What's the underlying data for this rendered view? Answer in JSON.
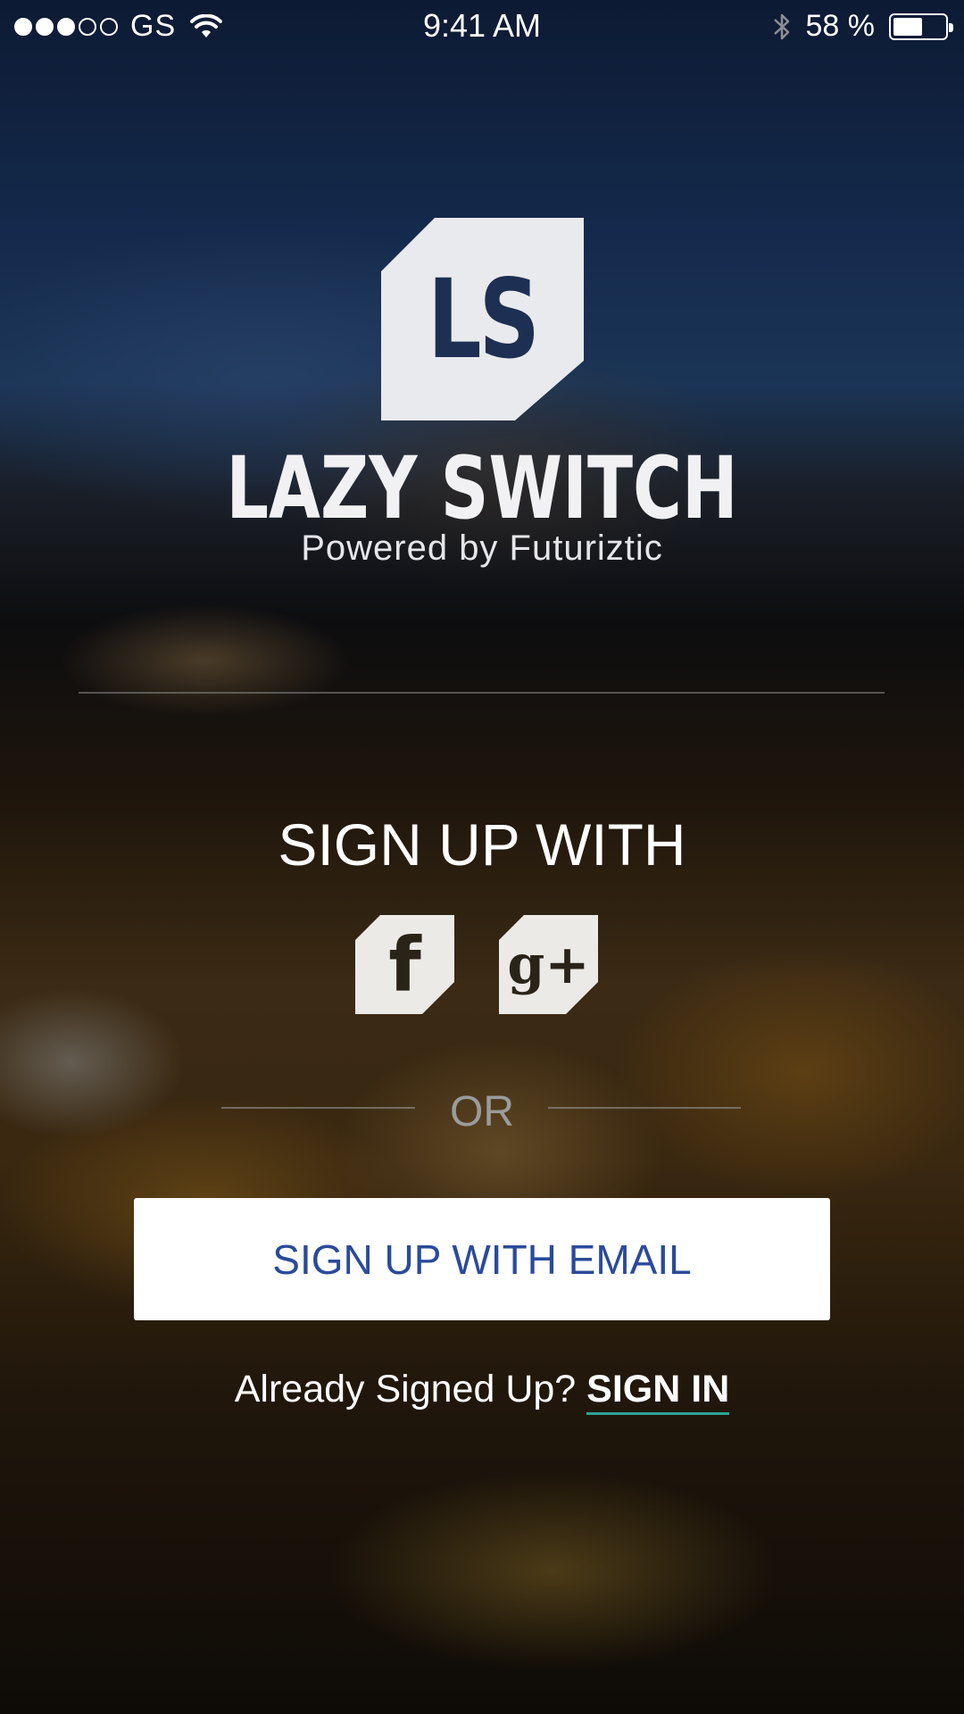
{
  "status_bar": {
    "carrier": "GS",
    "time": "9:41 AM",
    "battery_percent": "58 %",
    "battery_level": 0.58,
    "signal_bars": 3,
    "signal_total": 5
  },
  "logo": {
    "letters": "LS",
    "app_name": "LAZY SWITCH",
    "tagline": "Powered by Futuriztic"
  },
  "signup": {
    "heading": "SIGN UP WITH",
    "facebook_glyph": "f",
    "google_glyph": "g+",
    "or_text": "OR",
    "email_button": "SIGN UP WITH EMAIL"
  },
  "signin": {
    "prompt": "Already Signed Up? ",
    "link": "SIGN IN",
    "accent_color": "#2fa394"
  },
  "colors": {
    "brand_navy": "#1d2f52",
    "button_text": "#2b4a9a"
  }
}
